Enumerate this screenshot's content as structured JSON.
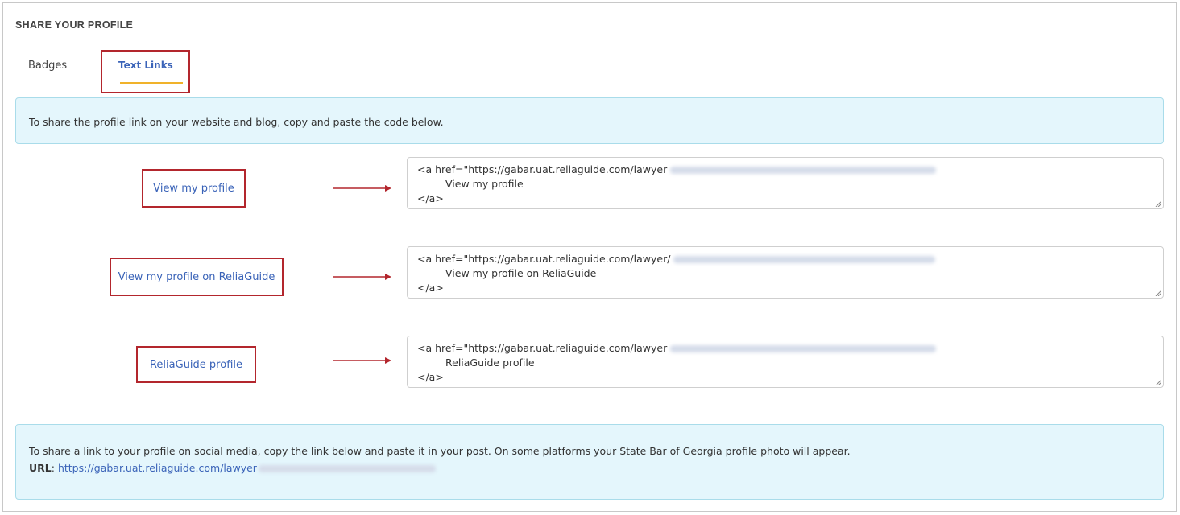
{
  "section_title": "SHARE YOUR PROFILE",
  "tabs": [
    {
      "label": "Badges",
      "active": false
    },
    {
      "label": "Text Links",
      "active": true
    }
  ],
  "info_top": "To share the profile link on your website and blog, copy and paste the code below.",
  "links": [
    {
      "label": "View my profile",
      "code_line1": "<a href=\"https://gabar.uat.reliaguide.com/lawyer",
      "code_line2": "View my profile",
      "code_line3": "</a>"
    },
    {
      "label": "View my profile on ReliaGuide",
      "code_line1": "<a href=\"https://gabar.uat.reliaguide.com/lawyer/",
      "code_line2": "View my profile on ReliaGuide",
      "code_line3": "</a>"
    },
    {
      "label": "ReliaGuide profile",
      "code_line1": "<a href=\"https://gabar.uat.reliaguide.com/lawyer",
      "code_line2": "ReliaGuide profile",
      "code_line3": "</a>"
    }
  ],
  "info_bottom": {
    "text": "To share a link to your profile on social media, copy the link below and paste it in your post. On some platforms your State Bar of Georgia profile photo will appear.",
    "url_label": "URL",
    "url_separator": ":",
    "url_value": "https://gabar.uat.reliaguide.com/lawyer"
  },
  "colors": {
    "accent_link": "#3a63b8",
    "annotation_red": "#b3262d",
    "tab_underline": "#f0b22a",
    "info_bg": "#e4f6fc",
    "info_border": "#a9dcea"
  }
}
